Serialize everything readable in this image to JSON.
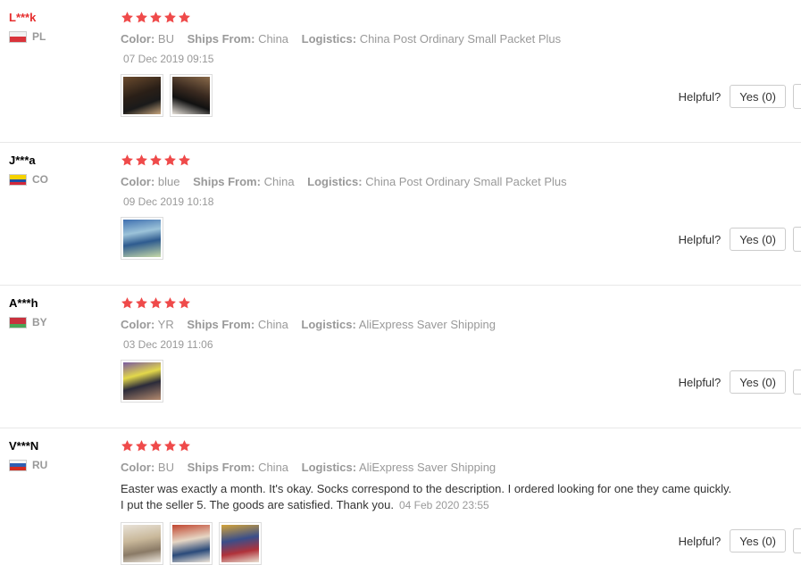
{
  "star_color": "#ef4a4a",
  "reviews": [
    {
      "user": "L***k",
      "country": "PL",
      "attrs": {
        "color_label": "Color:",
        "color": "BU",
        "ships_label": "Ships From:",
        "ships": "China",
        "logistics_label": "Logistics:",
        "logistics": "China Post Ordinary Small Packet Plus"
      },
      "date": "07 Dec 2019 09:15",
      "helpful": {
        "label": "Helpful?",
        "yes": "Yes (0)"
      }
    },
    {
      "user": "J***a",
      "country": "CO",
      "attrs": {
        "color_label": "Color:",
        "color": "blue",
        "ships_label": "Ships From:",
        "ships": "China",
        "logistics_label": "Logistics:",
        "logistics": "China Post Ordinary Small Packet Plus"
      },
      "date": "09 Dec 2019 10:18",
      "helpful": {
        "label": "Helpful?",
        "yes": "Yes (0)"
      }
    },
    {
      "user": "A***h",
      "country": "BY",
      "attrs": {
        "color_label": "Color:",
        "color": "YR",
        "ships_label": "Ships From:",
        "ships": "China",
        "logistics_label": "Logistics:",
        "logistics": "AliExpress Saver Shipping"
      },
      "date": "03 Dec 2019 11:06",
      "helpful": {
        "label": "Helpful?",
        "yes": "Yes (0)"
      }
    },
    {
      "user": "V***N",
      "country": "RU",
      "attrs": {
        "color_label": "Color:",
        "color": "BU",
        "ships_label": "Ships From:",
        "ships": "China",
        "logistics_label": "Logistics:",
        "logistics": "AliExpress Saver Shipping"
      },
      "text_line1": "Easter was exactly a month. It's okay. Socks correspond to the description. I ordered looking for one they came quickly.",
      "text_line2": "I put the seller 5. The goods are satisfied. Thank you.",
      "date": "04 Feb 2020 23:55",
      "helpful": {
        "label": "Helpful?",
        "yes": "Yes (0)"
      }
    }
  ]
}
